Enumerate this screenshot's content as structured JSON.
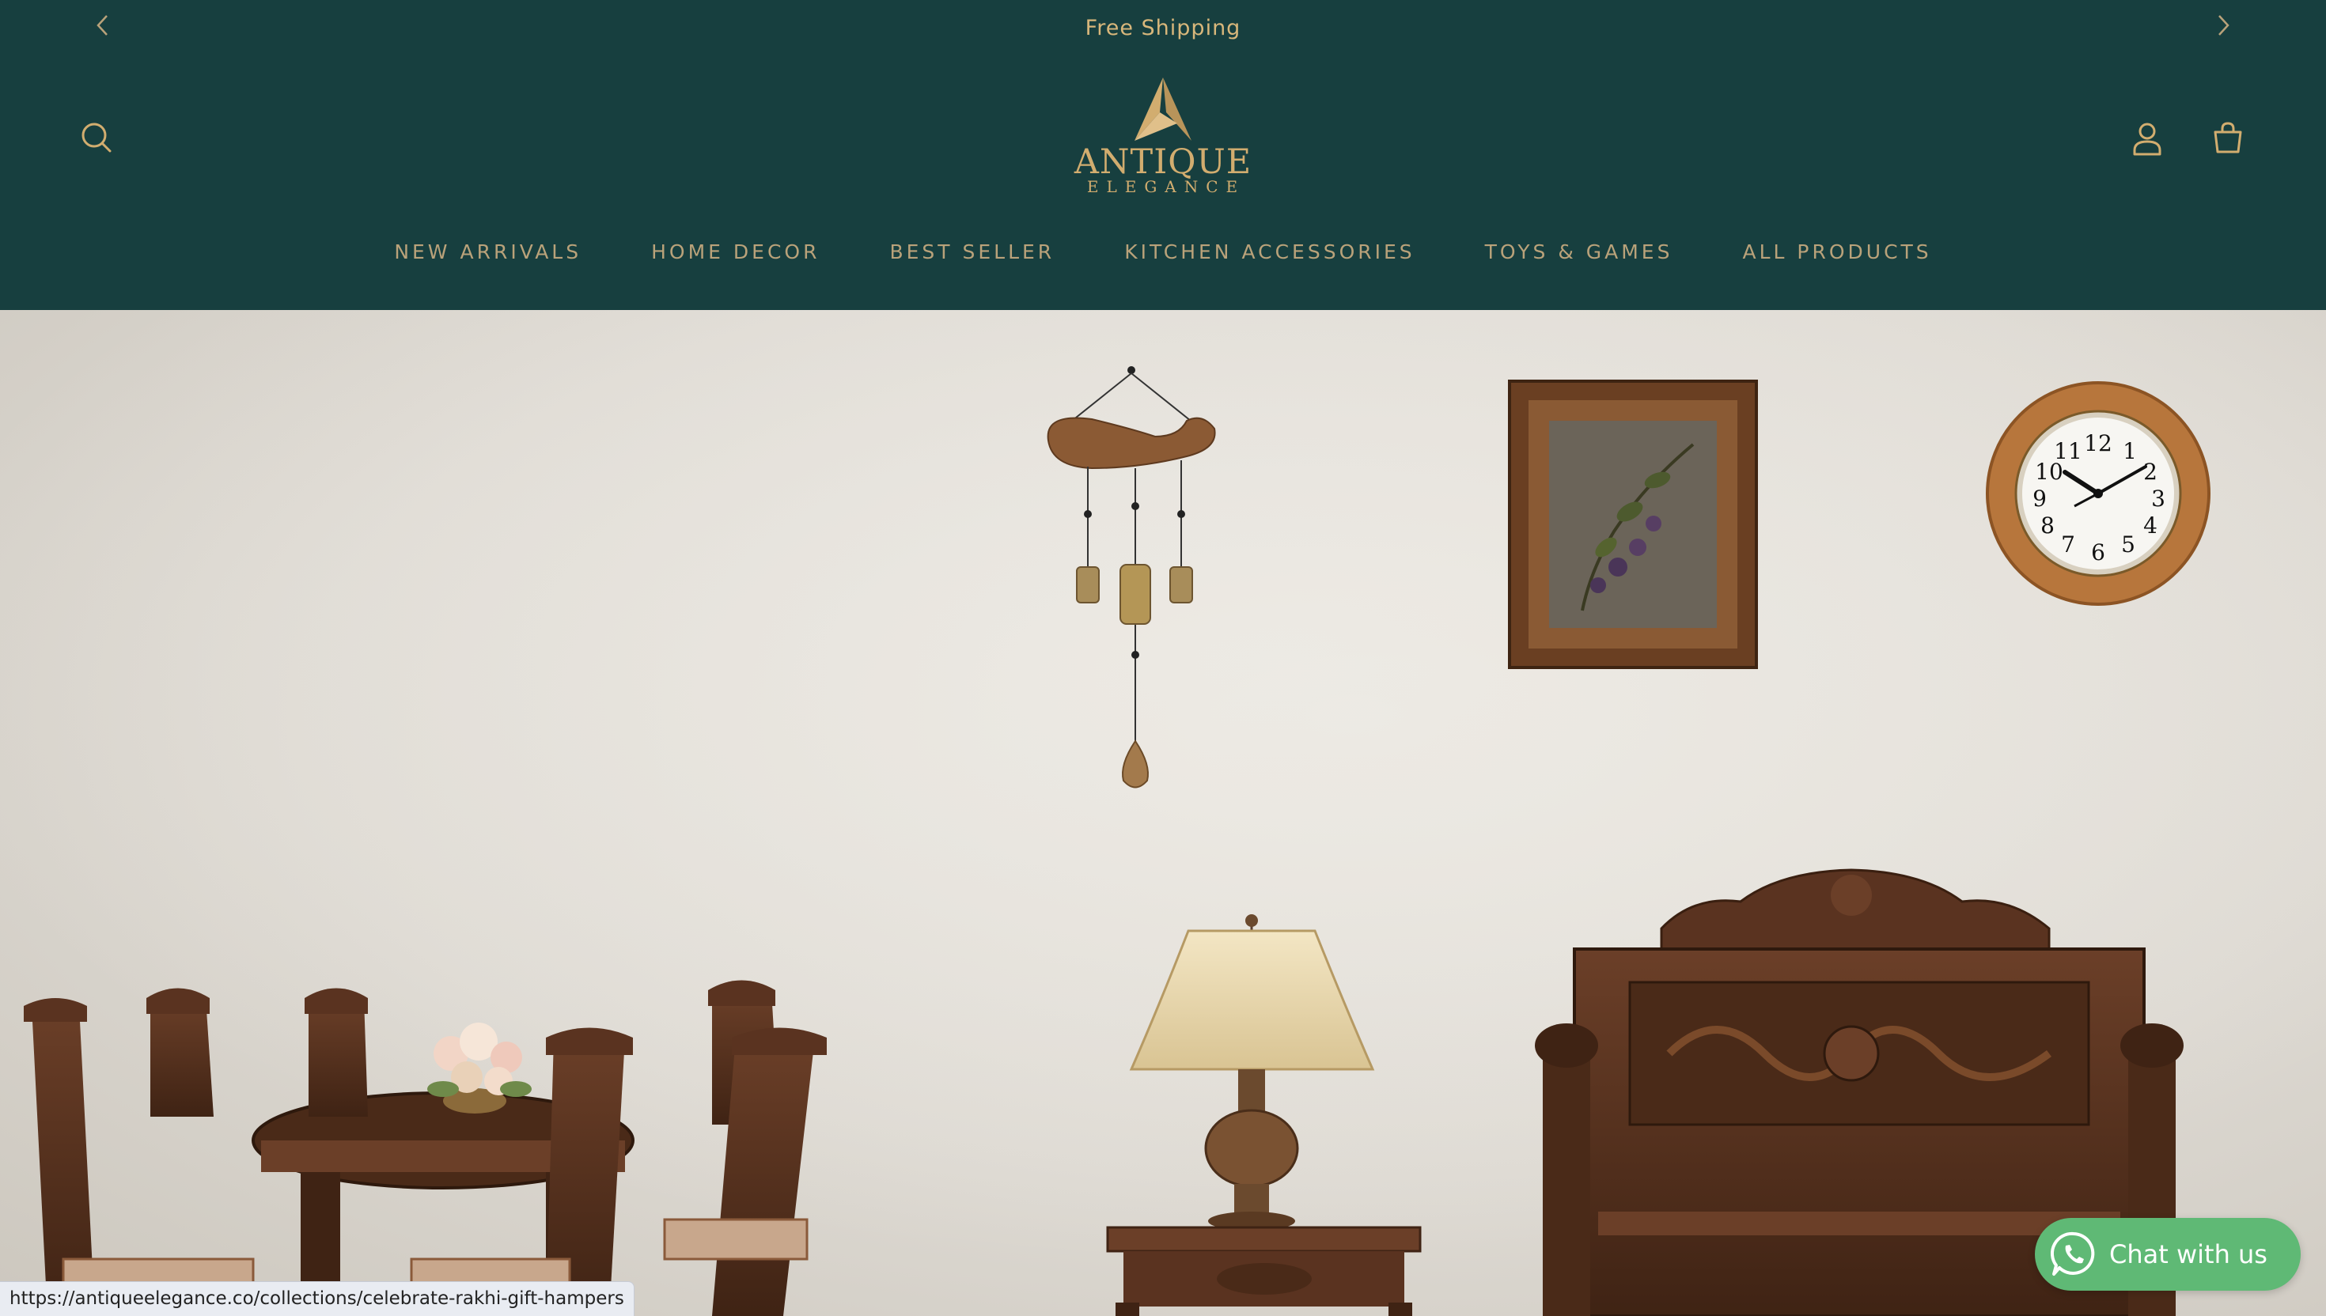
{
  "announcement": {
    "text": "Free Shipping",
    "prev_icon": "chevron-left-icon",
    "next_icon": "chevron-right-icon"
  },
  "header": {
    "search_icon": "search-icon",
    "account_icon": "account-icon",
    "cart_icon": "shopping-bag-icon",
    "logo": {
      "word": "ANTIQUE",
      "sub": "ELEGANCE"
    },
    "nav": [
      {
        "label": "NEW ARRIVALS"
      },
      {
        "label": "HOME DECOR"
      },
      {
        "label": "BEST SELLER"
      },
      {
        "label": "KITCHEN ACCESSORIES"
      },
      {
        "label": "TOYS & GAMES"
      },
      {
        "label": "ALL PRODUCTS"
      }
    ]
  },
  "chat_widget": {
    "label": "Chat with us",
    "icon": "whatsapp-icon"
  },
  "status_bar": {
    "url": "https://antiqueelegance.co/collections/celebrate-rakhi-gift-hampers"
  },
  "colors": {
    "header_bg": "#173f3f",
    "gold": "#d2ad6f",
    "nav_text": "#b9a27a",
    "whatsapp_green": "#5fb975"
  }
}
